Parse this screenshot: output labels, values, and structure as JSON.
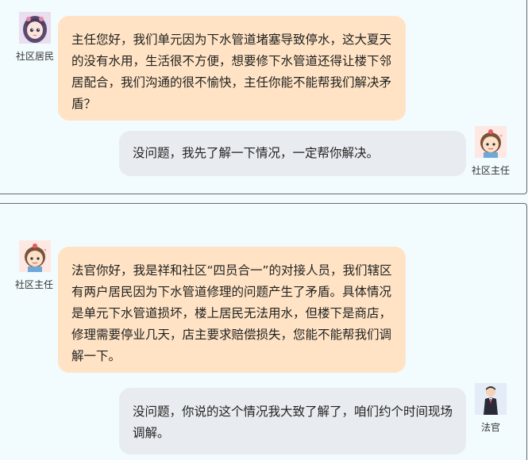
{
  "chat1": {
    "resident_label": "社区居民",
    "resident_message": "主任您好，我们单元因为下水管道堵塞导致停水，这大夏天的没有水用，生活很不方便，想要修下水管道还得让楼下邻居配合，我们沟通的很不愉快，主任你能不能帮我们解决矛盾？",
    "director_label": "社区主任",
    "director_message": "没问题，我先了解一下情况，一定帮你解决。"
  },
  "chat2": {
    "director_label": "社区主任",
    "director_message": "法官你好，我是祥和社区“四员合一”的对接人员，我们辖区有两户居民因为下水管道修理的问题产生了矛盾。具体情况是单元下水管道损坏，楼上居民无法用水，但楼下是商店，修理需要停业几天，店主要求赔偿损失，您能不能帮我们调解一下。",
    "judge_label": "法官",
    "judge_message": "没问题，你说的这个情况我大致了解了，咱们约个时间现场调解。"
  },
  "colors": {
    "background": "#f2fbfe",
    "incoming_bubble": "#ffe3c4",
    "outgoing_bubble": "#e8ecf0"
  },
  "icons": {
    "resident": "girl-avatar-icon",
    "director": "director-avatar-icon",
    "judge": "judge-avatar-icon"
  }
}
